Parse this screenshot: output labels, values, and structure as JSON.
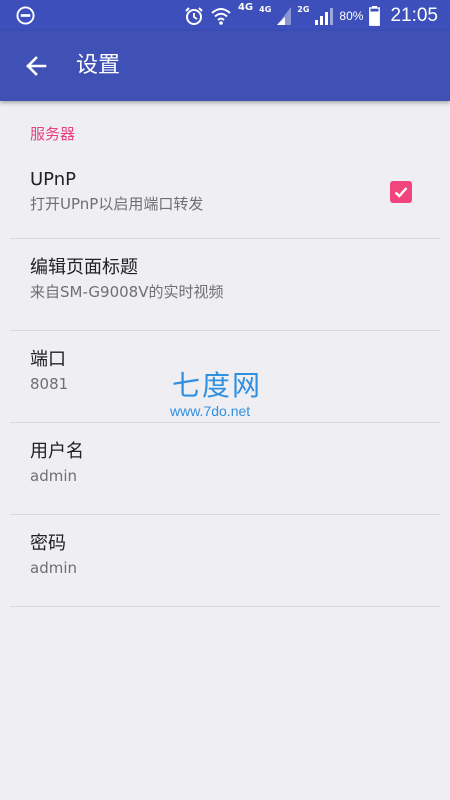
{
  "status_bar": {
    "network_4g": "4G",
    "sim1_tag": "4G",
    "sim2_tag": "2G",
    "battery": "80%",
    "time": "21:05"
  },
  "app_bar": {
    "title": "设置"
  },
  "settings": {
    "category": "服务器",
    "items": [
      {
        "title": "UPnP",
        "summary": "打开UPnP以启用端口转发",
        "checked": true
      },
      {
        "title": "编辑页面标题",
        "summary": "来自SM-G9008V的实时视频"
      },
      {
        "title": "端口",
        "summary": "8081"
      },
      {
        "title": "用户名",
        "summary": "admin"
      },
      {
        "title": "密码",
        "summary": "admin"
      }
    ]
  },
  "watermark": {
    "logo": "七度网",
    "url": "www.7do.net"
  },
  "colors": {
    "status_bar": "#3c4fbb",
    "app_bar": "#3f51b5",
    "accent": "#e5407f",
    "checkbox": "#f2457d",
    "background": "#efeff3"
  }
}
